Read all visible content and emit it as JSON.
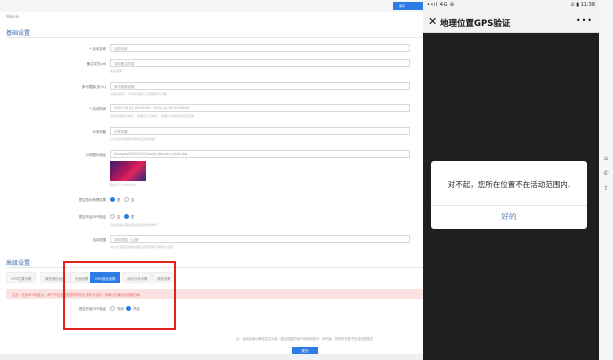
{
  "admin": {
    "top_title": "Weixin",
    "top_right_button": "保存",
    "section_basic": "基础设置",
    "section_advanced": "高级设置",
    "fields": [
      {
        "label": "* 活动名称",
        "value": "活动名称",
        "hint": ""
      },
      {
        "label": "备注文件(id)",
        "value": "活动备注内容",
        "hint": "备注说明"
      },
      {
        "label": "参与限制(天/人)",
        "value": "参与限制说明",
        "hint": "请填写数字，不填写则默认不限制参与次数"
      },
      {
        "label": "* 活动时间",
        "value": "2020-10-21 00:00:00 - 2021-12-30 00:00:00",
        "hint": "活动开始后可参与，结束后不可参与，请确认活动时间设置正确"
      },
      {
        "label": "分享标题",
        "value": "分享标题",
        "hint": "分享给好友或朋友圈时显示的标题"
      },
      {
        "label": "分享图片地址",
        "value": "/images/20201021/share_banner_cover.jpg",
        "hint": "建议尺寸 500*400"
      },
      {
        "label": "是否显示地理位置",
        "value": "",
        "hint": ""
      },
      {
        "label": "是否开启GPS验证",
        "value": "",
        "hint": "开启后用户需在活动范围内才能参与"
      },
      {
        "label": "活动范围",
        "value": "活动范围（公里）",
        "hint": "用户位置距活动地点超过此范围时不能参与活动"
      }
    ],
    "radio_yes": "是",
    "radio_no": "否",
    "tabs": [
      "GPS位置设置",
      "微信授权设置",
      "页面设置",
      "GPS验证设置",
      "活动分享设置",
      "其他设置"
    ],
    "warning": "注意：开启GPS验证后，用户不在活动范围内时将无法参与活动，请确认位置信息设置正确。",
    "gps_toggle_label": "是否开启GPS验证",
    "gps_off": "关闭",
    "gps_on": "开启",
    "footer_note": "注：活动位置以微信定位为准，超出范围的用户将收到提示：对不起，您所在位置不在活动范围内",
    "submit_label": "提交"
  },
  "phone": {
    "status_left": "••ıl 4G ⊛",
    "status_right": "⊙ ▮ 11:38",
    "title": "地理位置GPS验证",
    "close_icon": "close-icon",
    "more_icon": "more-icon",
    "dialog_message": "对不起，您所在位置不在活动范围内.",
    "dialog_ok": "好的"
  },
  "colors": {
    "accent": "#2d7be5",
    "highlight_box": "#e0241b",
    "warning_bg": "#fbe3e3",
    "dialog_ok": "#5a7bb8"
  }
}
